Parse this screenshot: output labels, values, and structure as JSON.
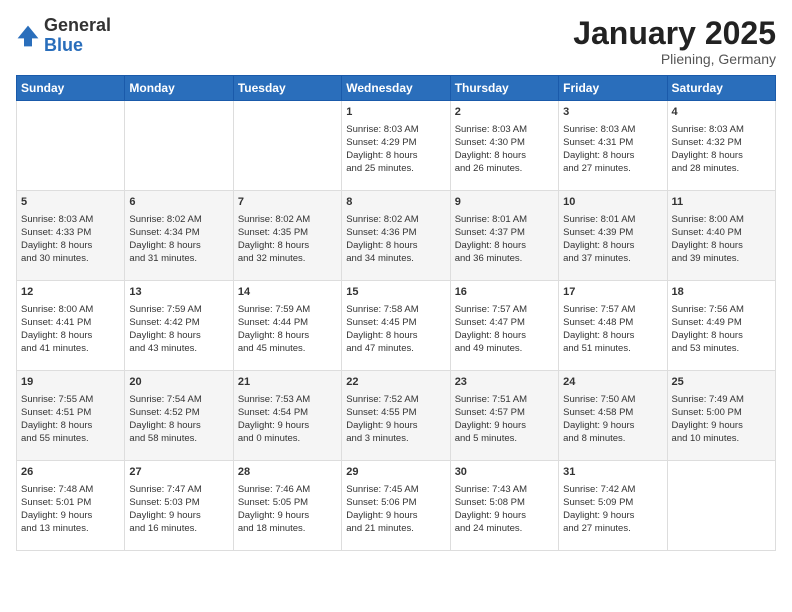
{
  "header": {
    "logo_general": "General",
    "logo_blue": "Blue",
    "month_title": "January 2025",
    "location": "Pliening, Germany"
  },
  "days_of_week": [
    "Sunday",
    "Monday",
    "Tuesday",
    "Wednesday",
    "Thursday",
    "Friday",
    "Saturday"
  ],
  "weeks": [
    [
      {
        "num": "",
        "info": ""
      },
      {
        "num": "",
        "info": ""
      },
      {
        "num": "",
        "info": ""
      },
      {
        "num": "1",
        "info": "Sunrise: 8:03 AM\nSunset: 4:29 PM\nDaylight: 8 hours\nand 25 minutes."
      },
      {
        "num": "2",
        "info": "Sunrise: 8:03 AM\nSunset: 4:30 PM\nDaylight: 8 hours\nand 26 minutes."
      },
      {
        "num": "3",
        "info": "Sunrise: 8:03 AM\nSunset: 4:31 PM\nDaylight: 8 hours\nand 27 minutes."
      },
      {
        "num": "4",
        "info": "Sunrise: 8:03 AM\nSunset: 4:32 PM\nDaylight: 8 hours\nand 28 minutes."
      }
    ],
    [
      {
        "num": "5",
        "info": "Sunrise: 8:03 AM\nSunset: 4:33 PM\nDaylight: 8 hours\nand 30 minutes."
      },
      {
        "num": "6",
        "info": "Sunrise: 8:02 AM\nSunset: 4:34 PM\nDaylight: 8 hours\nand 31 minutes."
      },
      {
        "num": "7",
        "info": "Sunrise: 8:02 AM\nSunset: 4:35 PM\nDaylight: 8 hours\nand 32 minutes."
      },
      {
        "num": "8",
        "info": "Sunrise: 8:02 AM\nSunset: 4:36 PM\nDaylight: 8 hours\nand 34 minutes."
      },
      {
        "num": "9",
        "info": "Sunrise: 8:01 AM\nSunset: 4:37 PM\nDaylight: 8 hours\nand 36 minutes."
      },
      {
        "num": "10",
        "info": "Sunrise: 8:01 AM\nSunset: 4:39 PM\nDaylight: 8 hours\nand 37 minutes."
      },
      {
        "num": "11",
        "info": "Sunrise: 8:00 AM\nSunset: 4:40 PM\nDaylight: 8 hours\nand 39 minutes."
      }
    ],
    [
      {
        "num": "12",
        "info": "Sunrise: 8:00 AM\nSunset: 4:41 PM\nDaylight: 8 hours\nand 41 minutes."
      },
      {
        "num": "13",
        "info": "Sunrise: 7:59 AM\nSunset: 4:42 PM\nDaylight: 8 hours\nand 43 minutes."
      },
      {
        "num": "14",
        "info": "Sunrise: 7:59 AM\nSunset: 4:44 PM\nDaylight: 8 hours\nand 45 minutes."
      },
      {
        "num": "15",
        "info": "Sunrise: 7:58 AM\nSunset: 4:45 PM\nDaylight: 8 hours\nand 47 minutes."
      },
      {
        "num": "16",
        "info": "Sunrise: 7:57 AM\nSunset: 4:47 PM\nDaylight: 8 hours\nand 49 minutes."
      },
      {
        "num": "17",
        "info": "Sunrise: 7:57 AM\nSunset: 4:48 PM\nDaylight: 8 hours\nand 51 minutes."
      },
      {
        "num": "18",
        "info": "Sunrise: 7:56 AM\nSunset: 4:49 PM\nDaylight: 8 hours\nand 53 minutes."
      }
    ],
    [
      {
        "num": "19",
        "info": "Sunrise: 7:55 AM\nSunset: 4:51 PM\nDaylight: 8 hours\nand 55 minutes."
      },
      {
        "num": "20",
        "info": "Sunrise: 7:54 AM\nSunset: 4:52 PM\nDaylight: 8 hours\nand 58 minutes."
      },
      {
        "num": "21",
        "info": "Sunrise: 7:53 AM\nSunset: 4:54 PM\nDaylight: 9 hours\nand 0 minutes."
      },
      {
        "num": "22",
        "info": "Sunrise: 7:52 AM\nSunset: 4:55 PM\nDaylight: 9 hours\nand 3 minutes."
      },
      {
        "num": "23",
        "info": "Sunrise: 7:51 AM\nSunset: 4:57 PM\nDaylight: 9 hours\nand 5 minutes."
      },
      {
        "num": "24",
        "info": "Sunrise: 7:50 AM\nSunset: 4:58 PM\nDaylight: 9 hours\nand 8 minutes."
      },
      {
        "num": "25",
        "info": "Sunrise: 7:49 AM\nSunset: 5:00 PM\nDaylight: 9 hours\nand 10 minutes."
      }
    ],
    [
      {
        "num": "26",
        "info": "Sunrise: 7:48 AM\nSunset: 5:01 PM\nDaylight: 9 hours\nand 13 minutes."
      },
      {
        "num": "27",
        "info": "Sunrise: 7:47 AM\nSunset: 5:03 PM\nDaylight: 9 hours\nand 16 minutes."
      },
      {
        "num": "28",
        "info": "Sunrise: 7:46 AM\nSunset: 5:05 PM\nDaylight: 9 hours\nand 18 minutes."
      },
      {
        "num": "29",
        "info": "Sunrise: 7:45 AM\nSunset: 5:06 PM\nDaylight: 9 hours\nand 21 minutes."
      },
      {
        "num": "30",
        "info": "Sunrise: 7:43 AM\nSunset: 5:08 PM\nDaylight: 9 hours\nand 24 minutes."
      },
      {
        "num": "31",
        "info": "Sunrise: 7:42 AM\nSunset: 5:09 PM\nDaylight: 9 hours\nand 27 minutes."
      },
      {
        "num": "",
        "info": ""
      }
    ]
  ]
}
